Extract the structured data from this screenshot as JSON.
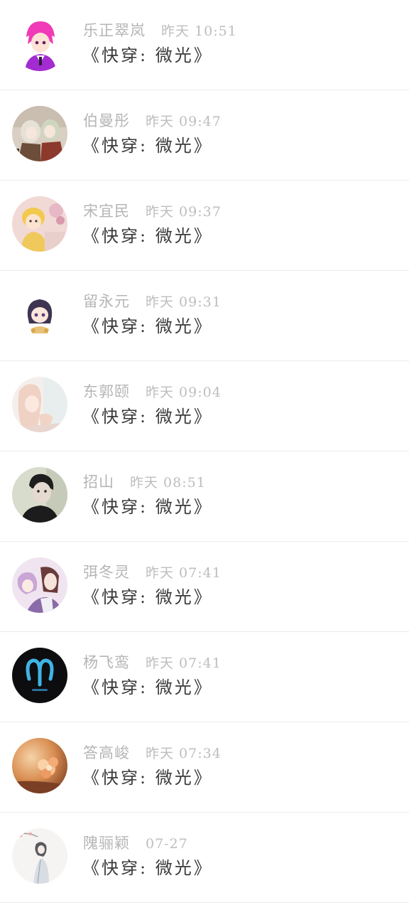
{
  "messages": [
    {
      "name": "乐正翠岚",
      "time": "昨天 10:51",
      "title": "《快穿: 微光》",
      "avatar": "pink-haired-anime-boy-avatar"
    },
    {
      "name": "伯曼彤",
      "time": "昨天 09:47",
      "title": "《快穿: 微光》",
      "avatar": "anime-girls-avatar"
    },
    {
      "name": "宋宜民",
      "time": "昨天 09:37",
      "title": "《快穿: 微光》",
      "avatar": "baby-doll-avatar"
    },
    {
      "name": "留永元",
      "time": "昨天 09:31",
      "title": "《快穿: 微光》",
      "avatar": "chibi-girl-avatar"
    },
    {
      "name": "东郭颐",
      "time": "昨天 09:04",
      "title": "《快穿: 微光》",
      "avatar": "pastel-girl-avatar"
    },
    {
      "name": "招山",
      "time": "昨天 08:51",
      "title": "《快穿: 微光》",
      "avatar": "man-portrait-avatar"
    },
    {
      "name": "弭冬灵",
      "time": "昨天 07:41",
      "title": "《快穿: 微光》",
      "avatar": "anime-couple-avatar"
    },
    {
      "name": "杨飞鸾",
      "time": "昨天 07:41",
      "title": "《快穿: 微光》",
      "avatar": "aries-zodiac-avatar"
    },
    {
      "name": "答高峻",
      "time": "昨天 07:34",
      "title": "《快穿: 微光》",
      "avatar": "flower-sunset-avatar"
    },
    {
      "name": "隗骊颖",
      "time": "07-27",
      "title": "《快穿: 微光》",
      "avatar": "ink-painting-girl-avatar"
    }
  ],
  "colors": {
    "name_text": "#b5b5b5",
    "title_text": "#3a3a3a",
    "divider": "#ececec",
    "background": "#ffffff"
  }
}
